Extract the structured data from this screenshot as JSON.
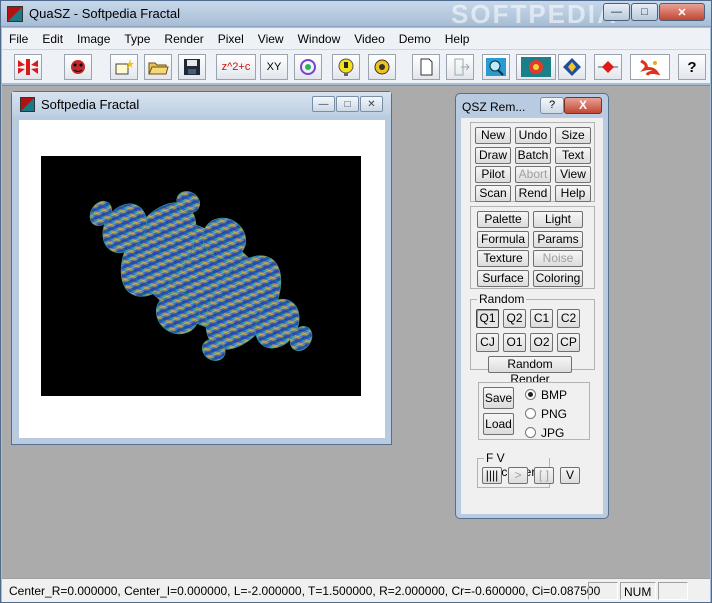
{
  "app": {
    "title": "QuaSZ - Softpedia Fractal",
    "watermark": "SOFTPEDIA"
  },
  "menu": [
    "File",
    "Edit",
    "Image",
    "Type",
    "Render",
    "Pixel",
    "View",
    "Window",
    "Video",
    "Demo",
    "Help"
  ],
  "toolbar": {
    "items": [
      {
        "icon": "fractal-logo-icon"
      },
      {
        "icon": "spider-icon"
      },
      {
        "icon": "new-sparkle-icon"
      },
      {
        "icon": "open-folder-icon"
      },
      {
        "icon": "save-disk-icon"
      },
      {
        "icon": "formula-text-icon",
        "label": "z^2+c"
      },
      {
        "icon": "xy-text-icon",
        "label": "XY"
      },
      {
        "icon": "palette-swirl-icon"
      },
      {
        "icon": "light-bulb-icon"
      },
      {
        "icon": "params-gear-icon"
      },
      {
        "icon": "new-page-icon"
      },
      {
        "icon": "exit-door-icon"
      },
      {
        "icon": "zoom-magnifier-icon"
      },
      {
        "icon": "render-planet-icon"
      },
      {
        "icon": "navigator-icon"
      },
      {
        "icon": "record-diamond-icon"
      },
      {
        "icon": "dragon-icon"
      },
      {
        "icon": "help-question-icon",
        "label": "?"
      }
    ]
  },
  "fractal_window": {
    "title": "Softpedia Fractal"
  },
  "qsz": {
    "title": "QSZ Rem...",
    "help_label": "?",
    "close_label": "X",
    "top_buttons": [
      {
        "label": "New"
      },
      {
        "label": "Undo"
      },
      {
        "label": "Size"
      },
      {
        "label": "Draw"
      },
      {
        "label": "Batch"
      },
      {
        "label": "Text"
      },
      {
        "label": "Pilot"
      },
      {
        "label": "Abort",
        "disabled": true
      },
      {
        "label": "View"
      },
      {
        "label": "Scan"
      },
      {
        "label": "Rend"
      },
      {
        "label": "Help"
      }
    ],
    "mid_buttons": [
      {
        "label": "Palette"
      },
      {
        "label": "Light"
      },
      {
        "label": "Formula"
      },
      {
        "label": "Params"
      },
      {
        "label": "Texture"
      },
      {
        "label": "Noise",
        "disabled": true
      },
      {
        "label": "Surface"
      },
      {
        "label": "Coloring"
      }
    ],
    "random": {
      "label": "Random",
      "buttons": [
        "Q1",
        "Q2",
        "C1",
        "C2",
        "CJ",
        "O1",
        "O2",
        "CP"
      ],
      "pressed": "Q1",
      "render_label": "Random Render"
    },
    "file": {
      "save_label": "Save",
      "load_label": "Load",
      "formats": [
        "BMP",
        "PNG",
        "JPG"
      ],
      "selected": "BMP"
    },
    "recorder": {
      "label": "F V Recorder",
      "buttons": [
        "||||",
        ">",
        "[ ]",
        "V"
      ]
    }
  },
  "status": {
    "text": "Center_R=0.000000, Center_I=0.000000, L=-2.000000, T=1.500000, R=2.000000, Cr=-0.600000, Ci=0.087500",
    "num": "NUM"
  }
}
